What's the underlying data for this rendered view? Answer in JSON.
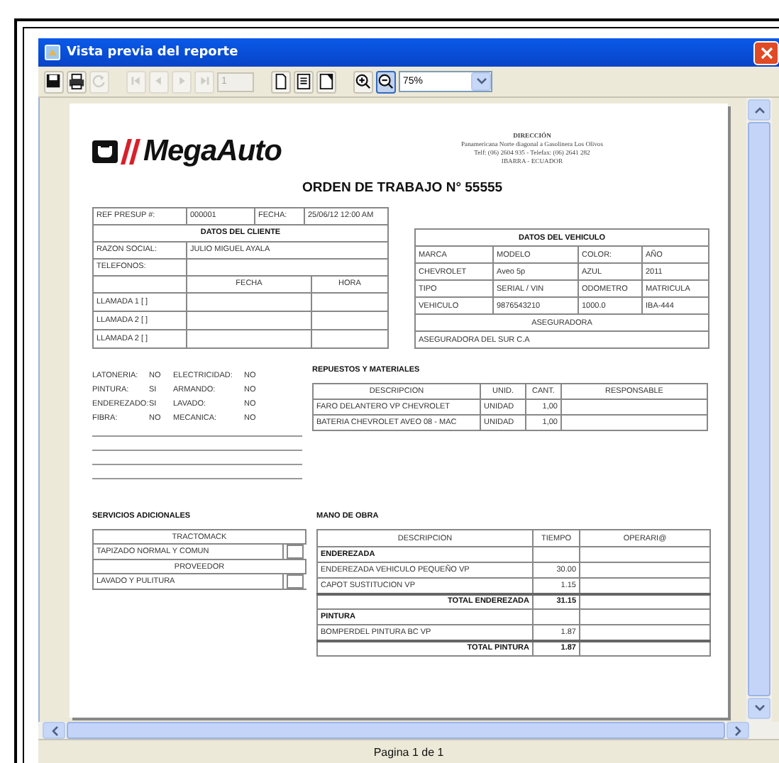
{
  "window": {
    "title": "Vista previa del reporte"
  },
  "toolbar": {
    "groups": [
      [
        {
          "kind": "save",
          "disabled": false,
          "pressed": false
        },
        {
          "kind": "print",
          "disabled": false,
          "pressed": false
        },
        {
          "kind": "refresh",
          "disabled": true,
          "pressed": false
        }
      ],
      [
        {
          "kind": "first",
          "disabled": true,
          "pressed": false
        },
        {
          "kind": "previous",
          "disabled": true,
          "pressed": false
        },
        {
          "kind": "next",
          "disabled": true,
          "pressed": false
        },
        {
          "kind": "last",
          "disabled": true,
          "pressed": false
        },
        {
          "kind": "page_field",
          "value": "1",
          "disabled": true
        }
      ],
      [
        {
          "kind": "single_page",
          "disabled": false,
          "pressed": false
        },
        {
          "kind": "page_lines",
          "disabled": false,
          "pressed": false
        },
        {
          "kind": "page_corner",
          "disabled": false,
          "pressed": false
        }
      ],
      [
        {
          "kind": "zoom_in",
          "disabled": false,
          "pressed": false
        },
        {
          "kind": "zoom_out",
          "disabled": false,
          "pressed": true
        },
        {
          "kind": "zoom_select",
          "value": "75%"
        }
      ]
    ]
  },
  "report": {
    "logo": "MegaAuto",
    "address": [
      "DIRECCIÓN",
      "Panamericana Norte diagonal a Gasolinera Los Olivos",
      "Telf: (06) 2604 935 - Telefax: (06) 2641 282",
      "IBARRA - ECUADOR"
    ],
    "title": "ORDEN DE TRABAJO N° 55555",
    "client": {
      "ref_label": "REF PRESUP #:",
      "ref_value": "000001",
      "date_label": "FECHA:",
      "date_value": "25/06/12 12:00 AM",
      "heading": "DATOS DEL CLIENTE",
      "name_label": "RAZON SOCIAL:",
      "name_value": "JULIO MIGUEL AYALA",
      "phone_label": "TELEFONOS:",
      "call_columns": [
        "FECHA",
        "HORA"
      ],
      "calls": [
        "LLAMADA 1 [ ]",
        "LLAMADA 2 [ ]",
        "LLAMADA 2 [ ]"
      ]
    },
    "vehicle": {
      "heading": "DATOS DEL VEHICULO",
      "rows": [
        [
          "MARCA",
          "MODELO",
          "COLOR:",
          "AÑO"
        ],
        [
          "CHEVROLET",
          "Aveo 5p",
          "AZUL",
          "2011"
        ],
        [
          "TIPO",
          "SERIAL / VIN",
          "ODOMETRO",
          "MATRICULA"
        ],
        [
          "VEHICULO",
          "9876543210",
          "1000.0",
          "IBA-444"
        ]
      ],
      "insurer_heading": "ASEGURADORA",
      "insurer": "ASEGURADORA DEL SUR C.A"
    },
    "work_areas": [
      {
        "label": "LATONERIA:",
        "value": "NO"
      },
      {
        "label": "ELECTRICIDAD:",
        "value": "NO"
      },
      {
        "label": "PINTURA:",
        "value": "SI"
      },
      {
        "label": "ARMANDO:",
        "value": "NO"
      },
      {
        "label": "ENDEREZADO:",
        "value": "SI"
      },
      {
        "label": "LAVADO:",
        "value": "NO"
      },
      {
        "label": "FIBRA:",
        "value": "NO"
      },
      {
        "label": "MECANICA:",
        "value": "NO"
      }
    ],
    "parts": {
      "title": "REPUESTOS Y MATERIALES",
      "columns": [
        "DESCRIPCION",
        "UNID.",
        "CANT.",
        "RESPONSABLE"
      ],
      "rows": [
        {
          "description": "FARO DELANTERO VP CHEVROLET",
          "unit": "UNIDAD",
          "quantity": "1,00"
        },
        {
          "description": "BATERIA CHEVROLET AVEO 08 - MAC",
          "unit": "UNIDAD",
          "quantity": "1,00"
        }
      ]
    },
    "services": {
      "title": "SERVICIOS ADICIONALES",
      "rows": [
        {
          "kind": "group",
          "text": "TRACTOMACK"
        },
        {
          "kind": "item",
          "text": "TAPIZADO NORMAL Y COMUN",
          "checked": false
        },
        {
          "kind": "group",
          "text": "PROVEEDOR"
        },
        {
          "kind": "item",
          "text": "LAVADO Y PULITURA",
          "checked": false
        }
      ]
    },
    "labor": {
      "title": "MANO DE OBRA",
      "columns": [
        "DESCRIPCION",
        "TIEMPO",
        "OPERARI@"
      ],
      "rows": [
        {
          "kind": "section",
          "text": "ENDEREZADA"
        },
        {
          "kind": "item",
          "text": "ENDEREZADA VEHICULO PEQUEÑO VP",
          "time": "30.00"
        },
        {
          "kind": "item",
          "text": "CAPOT SUSTITUCION VP",
          "time": "1.15"
        },
        {
          "kind": "total",
          "text": "TOTAL ENDEREZADA",
          "time": "31.15"
        },
        {
          "kind": "section",
          "text": "PINTURA"
        },
        {
          "kind": "item",
          "text": "BOMPERDEL PINTURA BC VP",
          "time": "1.87"
        },
        {
          "kind": "total",
          "text": "TOTAL PINTURA",
          "time": "1.87"
        }
      ]
    }
  },
  "status_bar": {
    "text": "Pagina 1 de 1"
  }
}
